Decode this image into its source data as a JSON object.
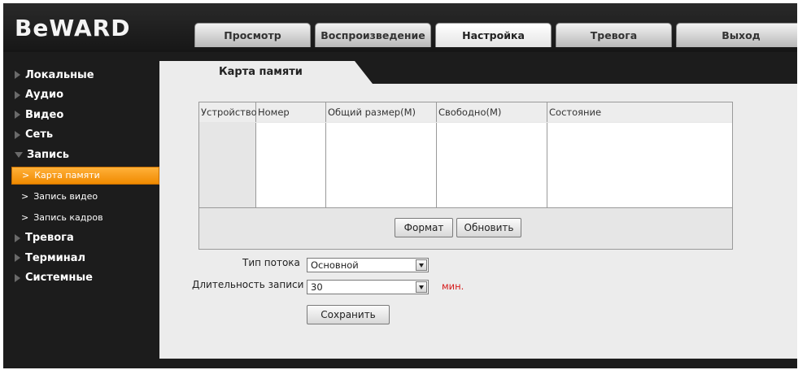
{
  "app": {
    "logo": "BeWARD"
  },
  "top_tabs": [
    {
      "label": "Просмотр",
      "active": false
    },
    {
      "label": "Воспроизведение",
      "active": false
    },
    {
      "label": "Настройка",
      "active": true
    },
    {
      "label": "Тревога",
      "active": false
    },
    {
      "label": "Выход",
      "active": false
    }
  ],
  "sidebar": {
    "items": [
      {
        "label": "Локальные"
      },
      {
        "label": "Аудио"
      },
      {
        "label": "Видео"
      },
      {
        "label": "Сеть"
      },
      {
        "label": "Запись",
        "expanded": true
      },
      {
        "label": "Тревога"
      },
      {
        "label": "Терминал"
      },
      {
        "label": "Системные"
      }
    ],
    "sub_items": [
      {
        "label": "Карта памяти",
        "active": true
      },
      {
        "label": "Запись видео",
        "active": false
      },
      {
        "label": "Запись кадров",
        "active": false
      }
    ]
  },
  "page": {
    "title": "Карта памяти",
    "table": {
      "columns": [
        "Устройство",
        "Номер",
        "Общий размер(M)",
        "Свободно(M)",
        "Состояние"
      ],
      "rows": []
    },
    "buttons": {
      "format": "Формат",
      "refresh": "Обновить",
      "save": "Сохранить"
    },
    "stream_type": {
      "label": "Тип потока",
      "value": "Основной"
    },
    "record_duration": {
      "label": "Длительность записи",
      "value": "30",
      "unit": "мин."
    }
  },
  "colors": {
    "accent": "#f59a12",
    "unit_text": "#d61a1a",
    "background_dark": "#1c1c1c",
    "panel": "#ececec"
  }
}
